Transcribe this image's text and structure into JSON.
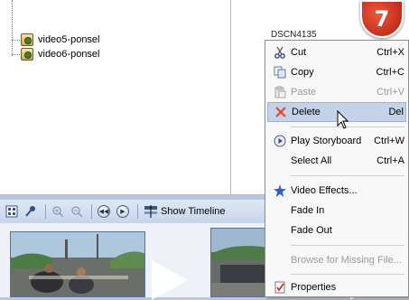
{
  "tree": {
    "items": [
      {
        "label": "video5-ponsel",
        "icon": "video-clip-icon"
      },
      {
        "label": "video6-ponsel",
        "icon": "video-clip-icon"
      }
    ]
  },
  "clip_title": "DSCN4135",
  "badge": {
    "number": "7",
    "color": "#c8261a"
  },
  "toolbar": {
    "show_timeline_label": "Show Timeline"
  },
  "context_menu": {
    "items": [
      {
        "label": "Cut",
        "shortcut": "Ctrl+X",
        "icon": "scissors-icon",
        "enabled": true
      },
      {
        "label": "Copy",
        "shortcut": "Ctrl+C",
        "icon": "copy-icon",
        "enabled": true
      },
      {
        "label": "Paste",
        "shortcut": "Ctrl+V",
        "icon": "paste-icon",
        "enabled": false
      },
      {
        "label": "Delete",
        "shortcut": "Del",
        "icon": "delete-x-icon",
        "enabled": true,
        "highlighted": true
      },
      {
        "label": "Play Storyboard",
        "shortcut": "Ctrl+W",
        "icon": "play-icon",
        "enabled": true
      },
      {
        "label": "Select All",
        "shortcut": "Ctrl+A",
        "icon": "",
        "enabled": true
      },
      {
        "label": "Video Effects...",
        "shortcut": "",
        "icon": "video-effects-star-icon",
        "enabled": true
      },
      {
        "label": "Fade In",
        "shortcut": "",
        "icon": "",
        "enabled": true
      },
      {
        "label": "Fade Out",
        "shortcut": "",
        "icon": "",
        "enabled": true
      },
      {
        "label": "Browse for Missing File...",
        "shortcut": "",
        "icon": "",
        "enabled": false
      },
      {
        "label": "Properties",
        "shortcut": "",
        "icon": "properties-checklist-icon",
        "enabled": true
      }
    ]
  }
}
